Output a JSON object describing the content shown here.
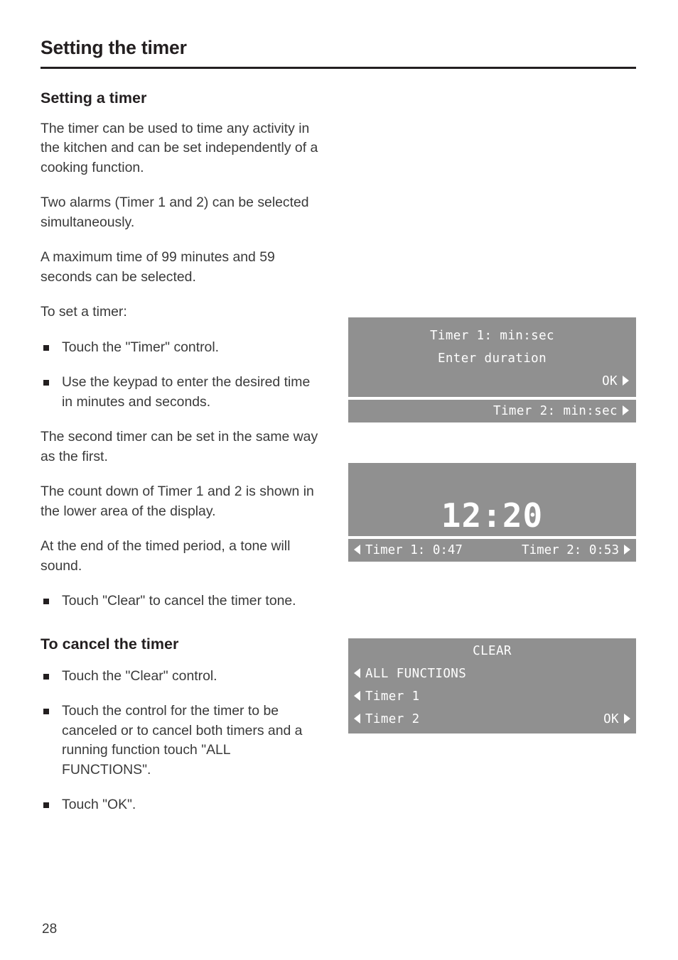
{
  "header": {
    "title": "Setting the timer"
  },
  "sections": {
    "setting_a_timer": {
      "heading": "Setting a timer",
      "paragraphs": [
        "The timer can be used to time any activity in the kitchen and can be set independently of a cooking function.",
        "Two alarms (Timer 1 and 2) can be selected simultaneously.",
        "A maximum time of 99 minutes and 59 seconds can be selected.",
        "To set a timer:"
      ],
      "bullets_1": [
        "Touch the \"Timer\" control.",
        "Use the keypad to enter the desired time in minutes and seconds."
      ],
      "paragraphs_2": [
        "The second timer can be set in the same way as the first.",
        "The count down of Timer 1 and 2 is shown in the lower area of the display.",
        "At the end of the timed period, a tone will sound."
      ],
      "bullets_2": [
        "Touch \"Clear\" to cancel the timer tone."
      ]
    },
    "to_cancel_the_timer": {
      "heading": "To cancel the timer",
      "bullets": [
        "Touch the \"Clear\" control.",
        "Touch the control for the timer to be canceled or to cancel both timers and a running function touch \"ALL FUNCTIONS\".",
        "Touch \"OK\"."
      ]
    }
  },
  "displays": {
    "panel_1": {
      "line_1": "Timer 1: min:sec",
      "line_2": "Enter duration",
      "ok_label": "OK",
      "footer_label": "Timer 2: min:sec"
    },
    "panel_2": {
      "clock": "12:20",
      "timer_1": "Timer 1: 0:47",
      "timer_2": "Timer 2: 0:53"
    },
    "panel_3": {
      "title": "CLEAR",
      "items": [
        "ALL FUNCTIONS",
        "Timer 1",
        "Timer 2"
      ],
      "ok_label": "OK"
    }
  },
  "footer": {
    "page_number": "28"
  },
  "colors": {
    "lcd_background": "#909090",
    "lcd_text": "#ffffff",
    "body_text": "#3a3a3a",
    "heading_text": "#231f20"
  }
}
